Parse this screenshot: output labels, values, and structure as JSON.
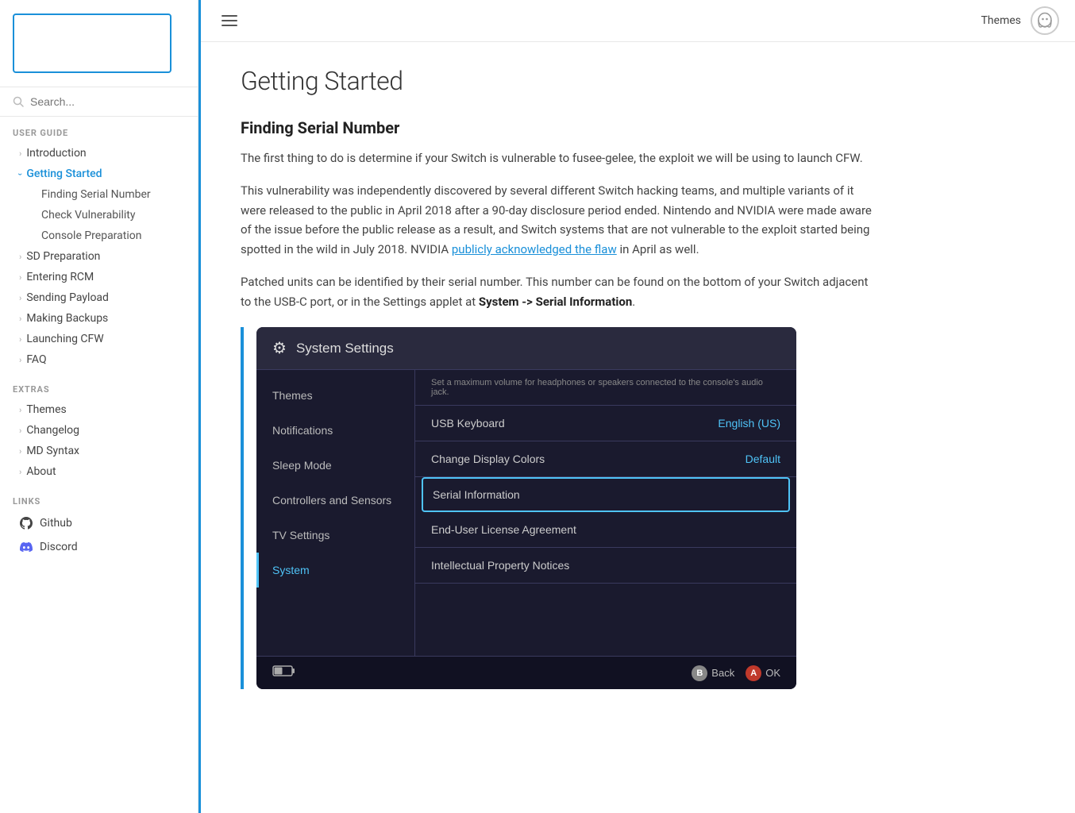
{
  "sidebar": {
    "sections": [
      {
        "title": "USER GUIDE",
        "items": [
          {
            "label": "Introduction",
            "active": false,
            "expandable": true,
            "children": []
          },
          {
            "label": "Getting Started",
            "active": true,
            "expandable": true,
            "children": [
              {
                "label": "Finding Serial Number"
              },
              {
                "label": "Check Vulnerability"
              },
              {
                "label": "Console Preparation"
              }
            ]
          },
          {
            "label": "SD Preparation",
            "active": false,
            "expandable": true,
            "children": []
          },
          {
            "label": "Entering RCM",
            "active": false,
            "expandable": true,
            "children": []
          },
          {
            "label": "Sending Payload",
            "active": false,
            "expandable": true,
            "children": []
          },
          {
            "label": "Making Backups",
            "active": false,
            "expandable": true,
            "children": []
          },
          {
            "label": "Launching CFW",
            "active": false,
            "expandable": true,
            "children": []
          },
          {
            "label": "FAQ",
            "active": false,
            "expandable": true,
            "children": []
          }
        ]
      },
      {
        "title": "EXTRAS",
        "items": [
          {
            "label": "Themes",
            "active": false,
            "expandable": true,
            "children": []
          },
          {
            "label": "Changelog",
            "active": false,
            "expandable": true,
            "children": []
          },
          {
            "label": "MD Syntax",
            "active": false,
            "expandable": true,
            "children": []
          },
          {
            "label": "About",
            "active": false,
            "expandable": true,
            "children": []
          }
        ]
      },
      {
        "title": "LINKS",
        "links": [
          {
            "label": "Github",
            "icon": "github"
          },
          {
            "label": "Discord",
            "icon": "discord"
          }
        ]
      }
    ],
    "search_placeholder": "Search..."
  },
  "topbar": {
    "themes_label": "Themes",
    "ghost_icon": "👻"
  },
  "content": {
    "page_title": "Getting Started",
    "section1_heading": "Finding Serial Number",
    "para1": "The first thing to do is determine if your Switch is vulnerable to fusee-gelee, the exploit we will be using to launch CFW.",
    "para2_parts": [
      {
        "text": "This vulnerability was independently discovered by several different Switch hacking teams, and multiple variants of it were released to the public in April 2018 after a 90-day disclosure period ended. Nintendo and NVIDIA were made aware of the issue before the public release as a result, and Switch systems that are not vulnerable to the exploit started being spotted in the wild in July 2018. NVIDIA "
      },
      {
        "text": "publicly acknowledged the flaw",
        "link": true
      },
      {
        "text": " in April as well."
      }
    ],
    "para3_parts": [
      {
        "text": "Patched units can be identified by their serial number. This number can be found on the bottom of your Switch adjacent to the USB-C port, or in the Settings applet at "
      },
      {
        "text": "System -> Serial Information",
        "bold": true
      },
      {
        "text": "."
      }
    ],
    "screenshot": {
      "title": "System Settings",
      "title_icon": "⚙",
      "top_note": "Set a maximum volume for headphones or speakers connected to the console's audio jack.",
      "menu_items": [
        {
          "label": "Themes",
          "active": false
        },
        {
          "label": "Notifications",
          "active": false
        },
        {
          "label": "Sleep Mode",
          "active": false
        },
        {
          "label": "Controllers and Sensors",
          "active": false
        },
        {
          "label": "TV Settings",
          "active": false
        },
        {
          "label": "System",
          "active": true
        }
      ],
      "rows": [
        {
          "label": "USB Keyboard",
          "value": "English (US)",
          "highlighted": false
        },
        {
          "label": "Change Display Colors",
          "value": "Default",
          "highlighted": false
        },
        {
          "label": "Serial Information",
          "value": "",
          "highlighted": true
        },
        {
          "label": "End-User License Agreement",
          "value": "",
          "highlighted": false
        },
        {
          "label": "Intellectual Property Notices",
          "value": "",
          "highlighted": false
        }
      ],
      "footer_back": "Back",
      "footer_ok": "OK"
    }
  }
}
